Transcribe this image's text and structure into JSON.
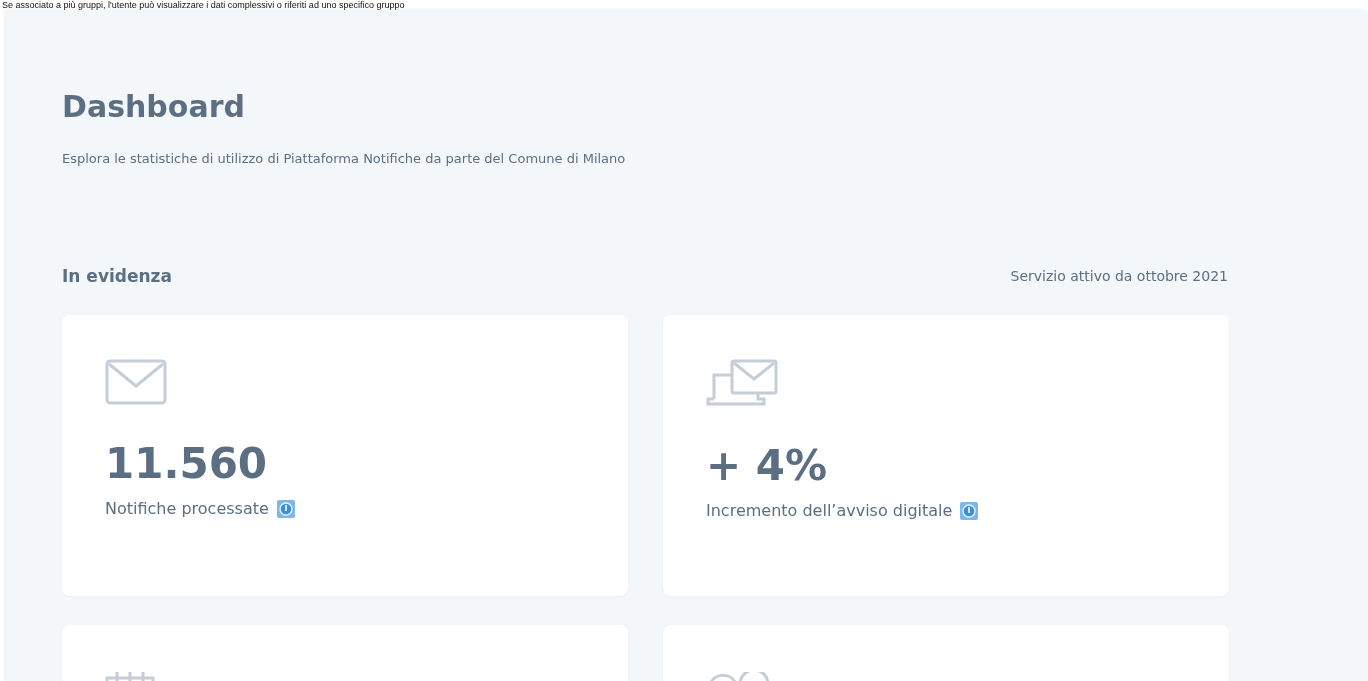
{
  "caption": "Se associato a più gruppi, l'utente può visualizzare i dati complessivi o riferiti ad uno specifico gruppo",
  "header": {
    "title": "Dashboard",
    "subtitle": "Esplora le statistiche di utilizzo di Piattaforma Notifiche da parte del Comune di Milano"
  },
  "section": {
    "title": "In evidenza",
    "note": "Servizio attivo da ottobre 2021"
  },
  "cards": [
    {
      "kind": "mail",
      "value": "11.560",
      "label": "Notifiche processate"
    },
    {
      "kind": "laptop",
      "value": "+ 4%",
      "label": "Incremento dell’avviso digitale"
    },
    {
      "kind": "calendar"
    },
    {
      "kind": "people"
    }
  ]
}
